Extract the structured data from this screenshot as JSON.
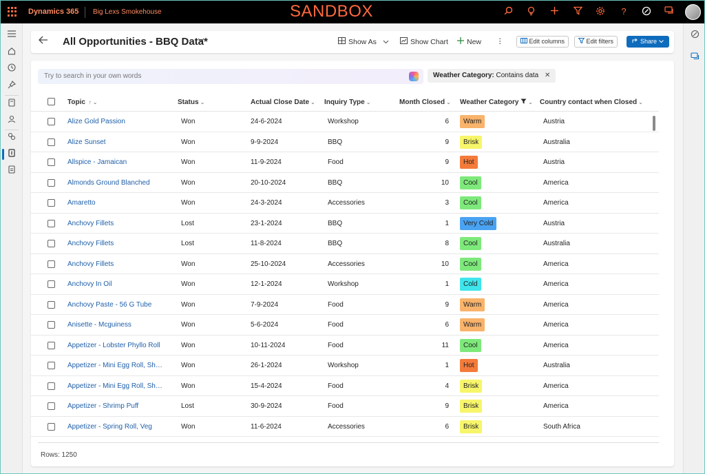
{
  "topbar": {
    "brand": "Dynamics 365",
    "app_name": "Big Lexs Smokehouse",
    "environment_banner": "SANDBOX",
    "icons": [
      "search-icon",
      "lightbulb-icon",
      "plus-icon",
      "filter-icon",
      "gear-icon",
      "help-icon",
      "copilot-icon",
      "chat-icon"
    ]
  },
  "left_rail": {
    "icons": [
      "menu-icon",
      "home-icon",
      "recent-icon",
      "pin-icon",
      "book-icon",
      "contact-icon",
      "handshake-icon",
      "opportunity-icon",
      "report-icon"
    ],
    "active_index": 7
  },
  "right_rail": {
    "icons": [
      "copilot-icon",
      "chat-icon"
    ]
  },
  "command_bar": {
    "back_icon": "arrow-left-icon",
    "view_title": "All Opportunities - BBQ Data*",
    "show_as": "Show As",
    "show_chart": "Show Chart",
    "new": "New",
    "edit_columns": "Edit columns",
    "edit_filters": "Edit filters",
    "share": "Share"
  },
  "search": {
    "placeholder": "Try to search in your own words"
  },
  "filter_chip": {
    "field": "Weather Category:",
    "condition": "Contains data"
  },
  "columns": {
    "topic": "Topic",
    "status": "Status",
    "close_date": "Actual Close Date",
    "inquiry_type": "Inquiry Type",
    "month_closed": "Month Closed",
    "weather_category": "Weather Category",
    "country": "Country contact when Closed"
  },
  "weather_colors": {
    "Warm": "#f9b36b",
    "Brisk": "#f7f56a",
    "Hot": "#f47b3a",
    "Cool": "#7ee97b",
    "Very Cold": "#4aa3f2",
    "Cold": "#3ee6ec"
  },
  "rows": [
    {
      "topic": "Alize Gold Passion",
      "status": "Won",
      "date": "24-6-2024",
      "inquiry": "Workshop",
      "month": "6",
      "weather": "Warm",
      "country": "Austria"
    },
    {
      "topic": "Alize Sunset",
      "status": "Won",
      "date": "9-9-2024",
      "inquiry": "BBQ",
      "month": "9",
      "weather": "Brisk",
      "country": "Australia"
    },
    {
      "topic": "Allspice - Jamaican",
      "status": "Won",
      "date": "11-9-2024",
      "inquiry": "Food",
      "month": "9",
      "weather": "Hot",
      "country": "Austria"
    },
    {
      "topic": "Almonds Ground Blanched",
      "status": "Won",
      "date": "20-10-2024",
      "inquiry": "BBQ",
      "month": "10",
      "weather": "Cool",
      "country": "America"
    },
    {
      "topic": "Amaretto",
      "status": "Won",
      "date": "24-3-2024",
      "inquiry": "Accessories",
      "month": "3",
      "weather": "Cool",
      "country": "America"
    },
    {
      "topic": "Anchovy Fillets",
      "status": "Lost",
      "date": "23-1-2024",
      "inquiry": "BBQ",
      "month": "1",
      "weather": "Very Cold",
      "country": "Austria"
    },
    {
      "topic": "Anchovy Fillets",
      "status": "Lost",
      "date": "11-8-2024",
      "inquiry": "BBQ",
      "month": "8",
      "weather": "Cool",
      "country": "Australia"
    },
    {
      "topic": "Anchovy Fillets",
      "status": "Won",
      "date": "25-10-2024",
      "inquiry": "Accessories",
      "month": "10",
      "weather": "Cool",
      "country": "America"
    },
    {
      "topic": "Anchovy In Oil",
      "status": "Won",
      "date": "12-1-2024",
      "inquiry": "Workshop",
      "month": "1",
      "weather": "Cold",
      "country": "America"
    },
    {
      "topic": "Anchovy Paste - 56 G Tube",
      "status": "Won",
      "date": "7-9-2024",
      "inquiry": "Food",
      "month": "9",
      "weather": "Warm",
      "country": "America"
    },
    {
      "topic": "Anisette - Mcguiness",
      "status": "Won",
      "date": "5-6-2024",
      "inquiry": "Food",
      "month": "6",
      "weather": "Warm",
      "country": "America"
    },
    {
      "topic": "Appetizer - Lobster Phyllo Roll",
      "status": "Won",
      "date": "10-11-2024",
      "inquiry": "Food",
      "month": "11",
      "weather": "Cool",
      "country": "America"
    },
    {
      "topic": "Appetizer - Mini Egg Roll, Shri...",
      "status": "Won",
      "date": "26-1-2024",
      "inquiry": "Workshop",
      "month": "1",
      "weather": "Hot",
      "country": "Australia"
    },
    {
      "topic": "Appetizer - Mini Egg Roll, Shri...",
      "status": "Won",
      "date": "15-4-2024",
      "inquiry": "Food",
      "month": "4",
      "weather": "Brisk",
      "country": "America"
    },
    {
      "topic": "Appetizer - Shrimp Puff",
      "status": "Lost",
      "date": "30-9-2024",
      "inquiry": "Food",
      "month": "9",
      "weather": "Brisk",
      "country": "America"
    },
    {
      "topic": "Appetizer - Spring Roll, Veg",
      "status": "Won",
      "date": "11-6-2024",
      "inquiry": "Accessories",
      "month": "6",
      "weather": "Brisk",
      "country": "South Africa"
    }
  ],
  "footer": {
    "rows_label": "Rows: 1250"
  }
}
